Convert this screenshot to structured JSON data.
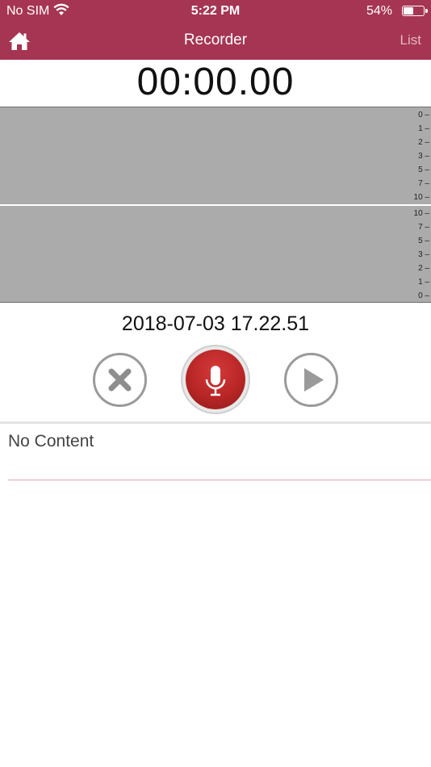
{
  "status_bar": {
    "carrier": "No SIM",
    "time": "5:22 PM",
    "battery_pct": "54%",
    "battery_level": 0.54
  },
  "navbar": {
    "title": "Recorder",
    "right_button": "List",
    "left_icon": "home-icon",
    "bar_color": "#a53552"
  },
  "timer": "00:00.00",
  "meters": {
    "top_ticks": [
      "0 –",
      "1 –",
      "2 –",
      "3 –",
      "5 –",
      "7 –",
      "10 –"
    ],
    "bottom_ticks": [
      "10 –",
      "7 –",
      "5 –",
      "3 –",
      "2 –",
      "1 –",
      "0 –"
    ]
  },
  "recording_name": "2018-07-03 17.22.51",
  "controls": {
    "cancel_icon": "x-icon",
    "record_icon": "microphone-icon",
    "play_icon": "play-icon",
    "record_color": "#b82626"
  },
  "content": {
    "empty_text": "No Content"
  }
}
